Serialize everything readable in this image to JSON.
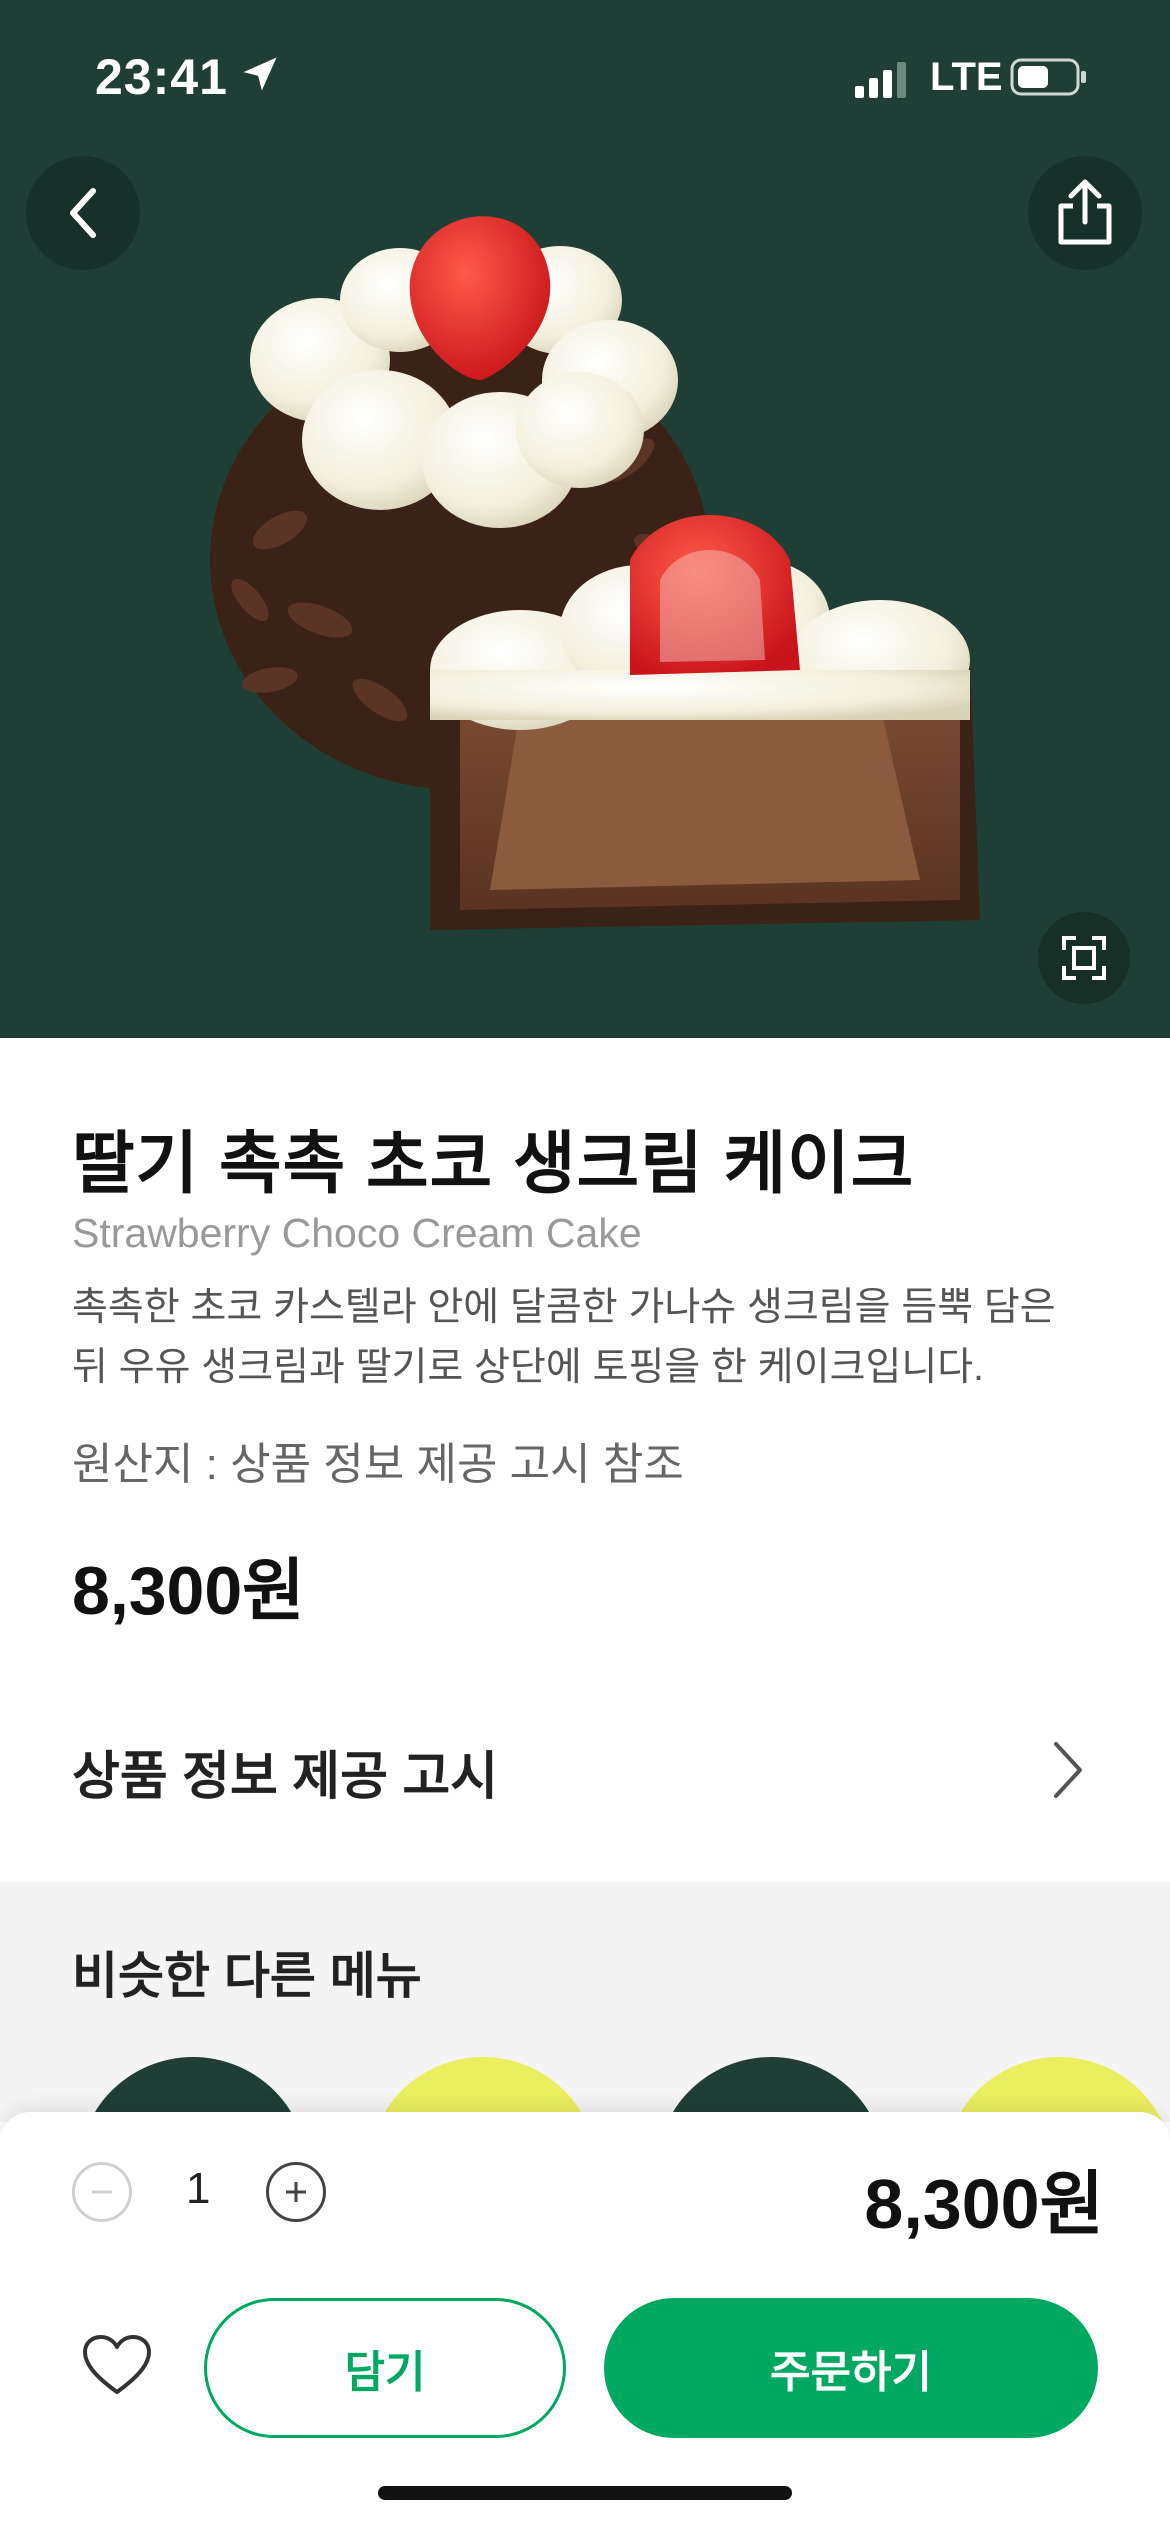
{
  "status_bar": {
    "time": "23:41",
    "network": "LTE"
  },
  "product": {
    "name": "딸기 촉촉 초코 생크림 케이크",
    "name_en": "Strawberry Choco Cream Cake",
    "description": "촉촉한 초코 카스텔라 안에 달콤한 가나슈 생크림을 듬뿍 담은 뒤 우유 생크림과 딸기로 상단에 토핑을 한 케이크입니다.",
    "origin": "원산지 : 상품 정보 제공 고시 참조",
    "price": "8,300원"
  },
  "info_notice": {
    "label": "상품 정보 제공 고시"
  },
  "similar": {
    "title": "비슷한 다른 메뉴"
  },
  "order_bar": {
    "quantity": "1",
    "total": "8,300원",
    "cart_label": "담기",
    "order_label": "주문하기"
  },
  "colors": {
    "brand_green": "#00a862",
    "hero_bg": "#1f3f36"
  },
  "icons": [
    "back-icon",
    "share-icon",
    "zoom-icon",
    "chevron-right-icon",
    "minus-icon",
    "plus-icon",
    "heart-icon"
  ]
}
